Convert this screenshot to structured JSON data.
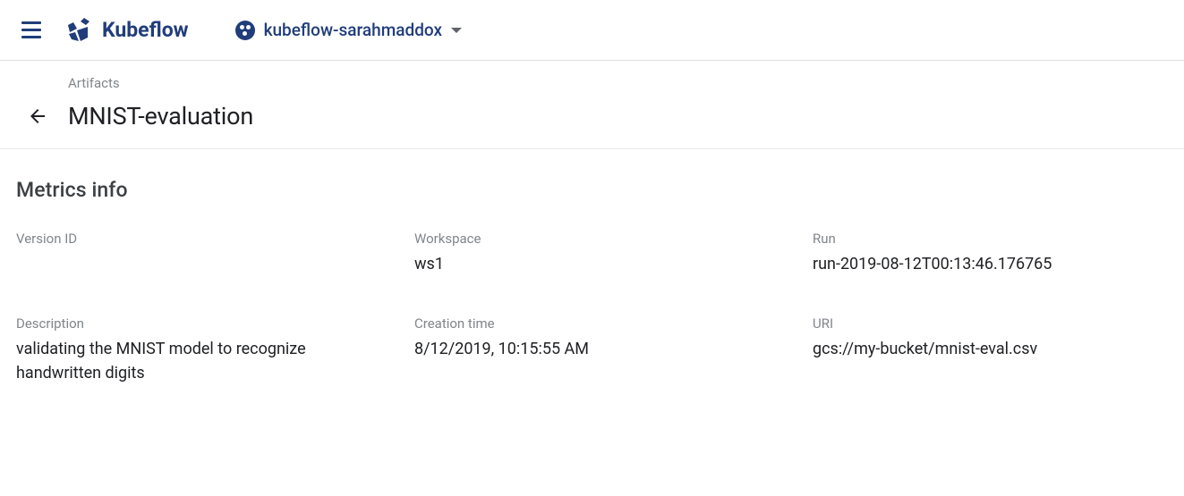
{
  "header": {
    "brand_name": "Kubeflow",
    "namespace": "kubeflow-sarahmaddox"
  },
  "breadcrumb": {
    "parent": "Artifacts",
    "title": "MNIST-evaluation"
  },
  "section": {
    "heading": "Metrics info"
  },
  "fields": {
    "version_id": {
      "label": "Version ID",
      "value": ""
    },
    "workspace": {
      "label": "Workspace",
      "value": "ws1"
    },
    "run": {
      "label": "Run",
      "value": "run-2019-08-12T00:13:46.176765"
    },
    "description": {
      "label": "Description",
      "value": "validating the MNIST model to recognize handwritten digits"
    },
    "creation_time": {
      "label": "Creation time",
      "value": "8/12/2019, 10:15:55 AM"
    },
    "uri": {
      "label": "URI",
      "value": "gcs://my-bucket/mnist-eval.csv"
    }
  }
}
